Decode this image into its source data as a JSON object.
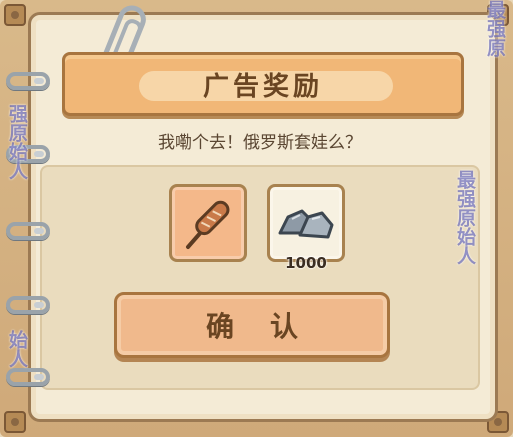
{
  "dialog": {
    "title": "广告奖励",
    "message": "我嘞个去！俄罗斯套娃么？",
    "confirm_label": "确认"
  },
  "rewards": [
    {
      "icon": "sausage-skewer-icon",
      "selected": true
    },
    {
      "icon": "stone-ore-icon",
      "count": "1000"
    }
  ],
  "watermark": {
    "text_right_top": "最强原",
    "text_right_mid": "最强原始人",
    "text_left_mid": "强原始人",
    "text_left_bottom": "始人"
  },
  "colors": {
    "banner": "#f1b777",
    "page": "#f4ebd6",
    "button": "#f0b98c",
    "text_dark": "#6a4522"
  }
}
